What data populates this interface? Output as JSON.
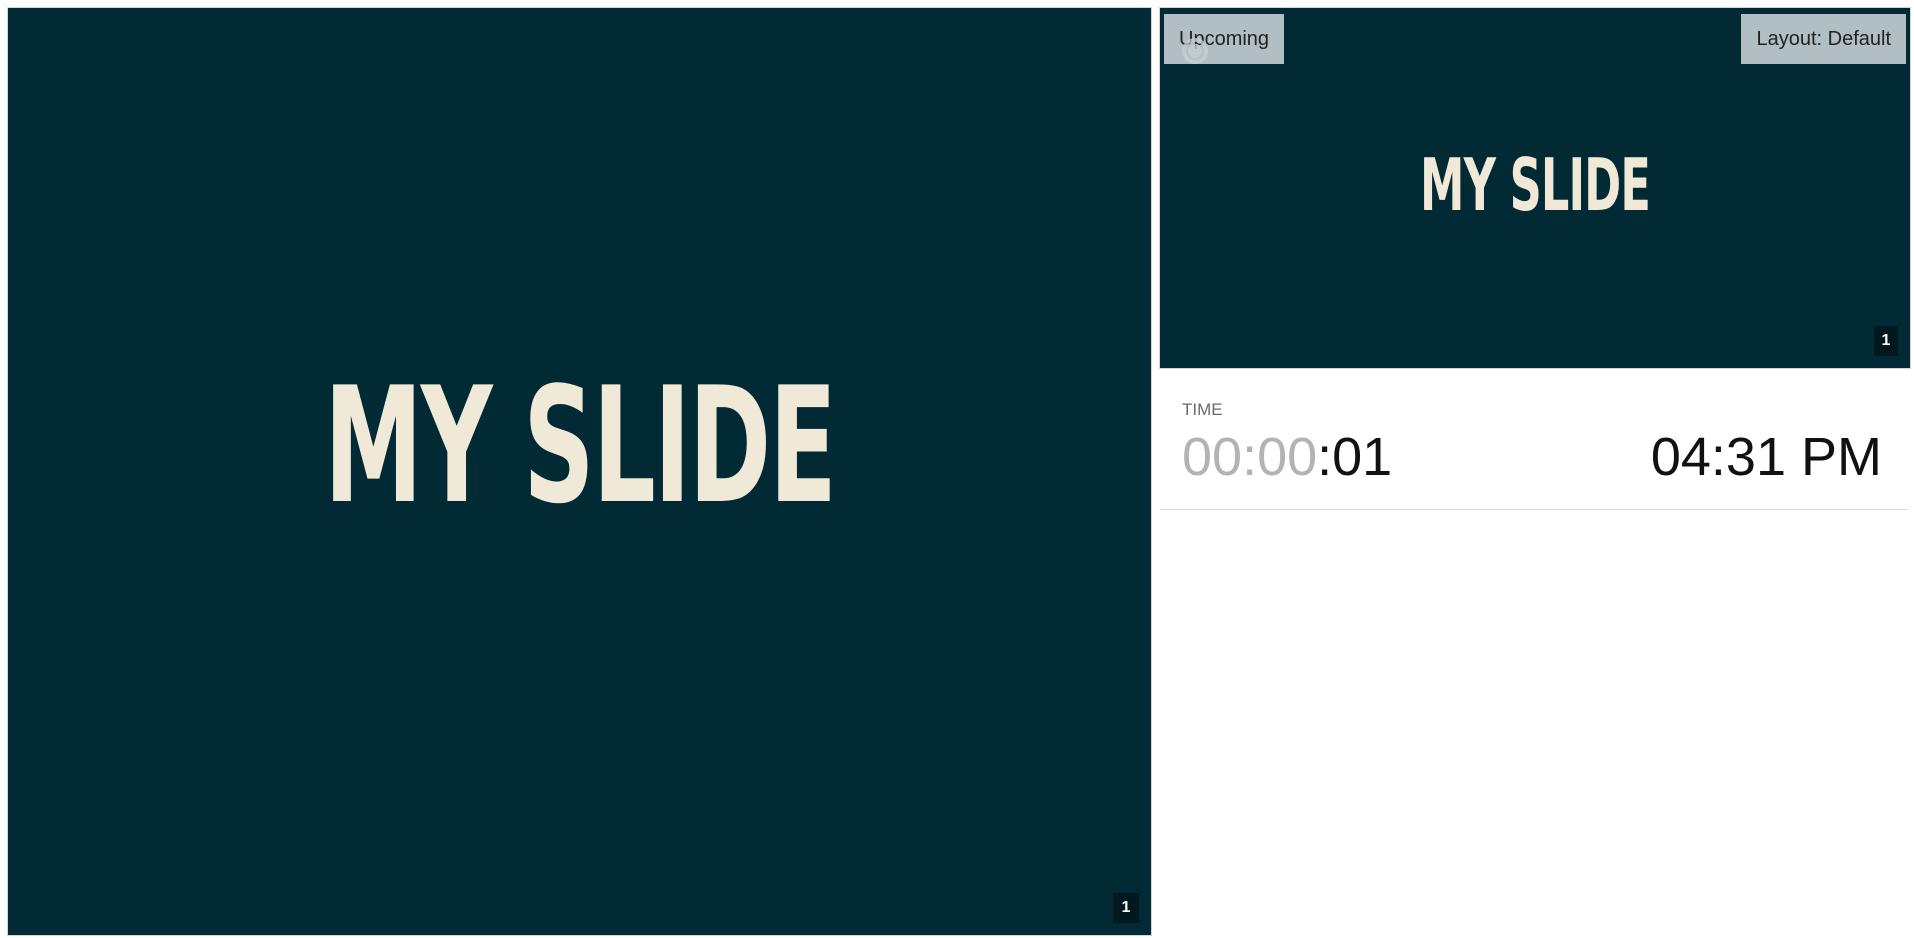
{
  "current_slide": {
    "title": "MY SLIDE",
    "number": "1"
  },
  "upcoming_slide": {
    "label": "Upcoming",
    "title": "MY SLIDE",
    "number": "1",
    "layout_label": "Layout: Default"
  },
  "time": {
    "label": "TIME",
    "elapsed_dim": "00:00",
    "elapsed_bright": ":01",
    "clock": "04:31 PM"
  },
  "icons": {
    "upcoming_overlay": "gear-icon"
  },
  "colors": {
    "slide_background": "#022a35",
    "slide_text": "#f0e9d8",
    "slide_number_background": "#01181e"
  }
}
